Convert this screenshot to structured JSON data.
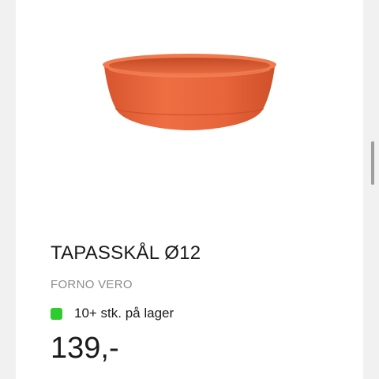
{
  "product": {
    "image_alt": "terracotta tapas bowl",
    "title": "TAPASSKÅL Ø12",
    "brand": "FORNO VERO",
    "stock": {
      "text": "10+ stk. på lager",
      "status_color": "#2ecc2e"
    },
    "price": "139,-"
  },
  "colors": {
    "bowl_main": "#e8643a",
    "bowl_dark": "#c94d28",
    "bowl_rim": "#f07a4e"
  }
}
